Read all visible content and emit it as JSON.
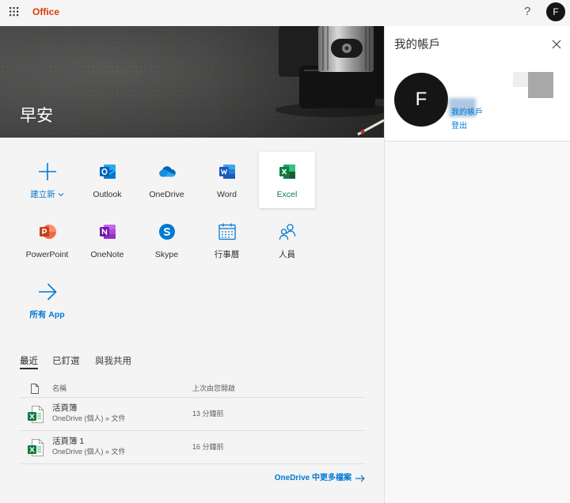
{
  "topbar": {
    "app_launcher_icon": "waffle-icon",
    "brand": "Office",
    "help": "?",
    "avatar_initial": "F"
  },
  "hero": {
    "greeting": "早安"
  },
  "apps": [
    {
      "label": "建立新",
      "icon": "plus-icon"
    },
    {
      "label": "Outlook",
      "icon": "outlook-icon"
    },
    {
      "label": "OneDrive",
      "icon": "onedrive-icon"
    },
    {
      "label": "Word",
      "icon": "word-icon"
    },
    {
      "label": "Excel",
      "icon": "excel-icon",
      "highlighted": true
    },
    {
      "label": "PowerPoint",
      "icon": "powerpoint-icon"
    },
    {
      "label": "OneNote",
      "icon": "onenote-icon"
    },
    {
      "label": "Skype",
      "icon": "skype-icon"
    },
    {
      "label": "行事曆",
      "icon": "calendar-icon"
    },
    {
      "label": "人員",
      "icon": "people-icon"
    },
    {
      "label": "所有 App",
      "icon": "arrow-right-icon"
    }
  ],
  "tabs": [
    {
      "label": "最近",
      "active": true
    },
    {
      "label": "已釘選",
      "active": false
    },
    {
      "label": "與我共用",
      "active": false
    }
  ],
  "files": {
    "header_name": "名稱",
    "header_opened": "上次由您開啟",
    "rows": [
      {
        "name": "活頁簿",
        "location": "OneDrive (個人) » 文件",
        "opened": "13 分鐘前",
        "icon": "excel-file-icon"
      },
      {
        "name": "活頁簿 1",
        "location": "OneDrive (個人) » 文件",
        "opened": "16 分鐘前",
        "icon": "excel-file-icon"
      }
    ],
    "more_link": "OneDrive 中更多檔案"
  },
  "account_panel": {
    "title": "我的帳戶",
    "avatar_initial": "F",
    "my_account_link": "我的帳戶",
    "sign_out": "登出"
  },
  "colors": {
    "brand": "#d83b01",
    "accent": "#0078d4",
    "excel_green": "#107c41",
    "text": "#323130"
  }
}
